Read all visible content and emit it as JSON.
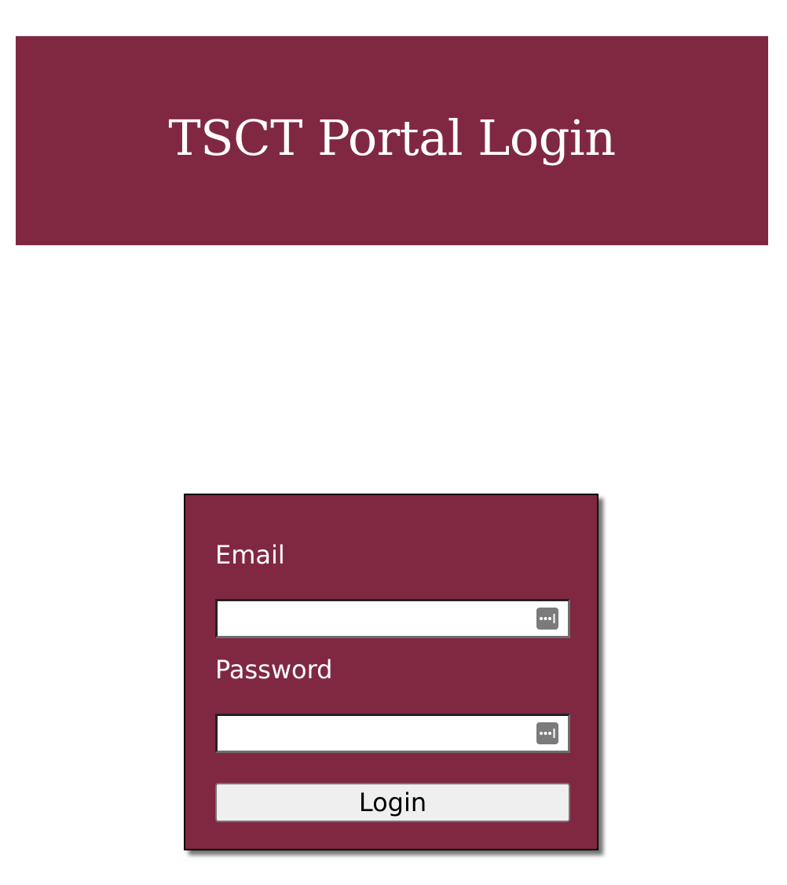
{
  "header": {
    "title": "TSCT Portal Login",
    "background_color": "#802842"
  },
  "login_form": {
    "email_label": "Email",
    "email_value": "",
    "password_label": "Password",
    "password_value": "",
    "login_button_label": "Login",
    "autofill_icon": "password-manager-key-icon"
  }
}
